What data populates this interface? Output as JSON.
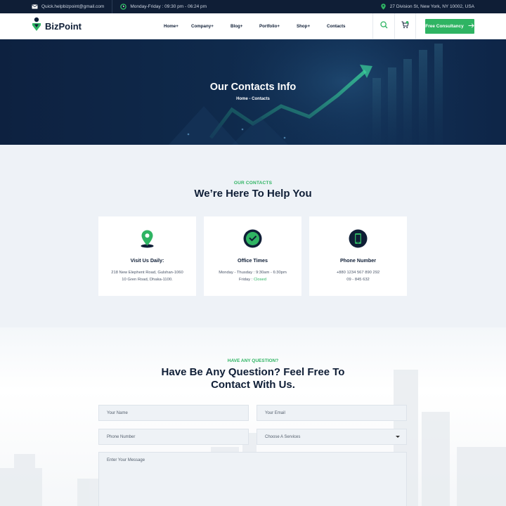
{
  "topbar": {
    "email": "Quick.helpbizpoint@gmail.com",
    "hours": "Monday-Friday : 09:30 pm - 06:24 pm",
    "address": "27 Division St, New York, NY 10002, USA",
    "icons": [
      "mail-icon",
      "clock-icon",
      "location-pin-icon"
    ]
  },
  "header": {
    "logo_text": "BizPoint",
    "nav": [
      "Home+",
      "Company+",
      "Blog+",
      "Portfolio+",
      "Shop+",
      "Contacts"
    ],
    "cta_label": "Free Consultancy",
    "icons": [
      "search-icon",
      "cart-icon",
      "arrow-right-icon"
    ]
  },
  "hero": {
    "title": "Our Contacts Info",
    "breadcrumb": "Home - Contacts"
  },
  "contacts": {
    "eyebrow": "OUR CONTACTS",
    "title": "We’re Here To Help You",
    "cards": [
      {
        "icon": "map-pin-icon",
        "title": "Visit Us Daily:",
        "line1": "218 New Elephent Road, Gulshan-1060",
        "line2": "10 Gren Road, Dhaka-1100."
      },
      {
        "icon": "clock-icon",
        "title": "Office Times",
        "line1": "Monday - Thusday : 9:30am - 6:30pm",
        "line2_prefix": "Friday : ",
        "line2_status": "Closed"
      },
      {
        "icon": "phone-icon",
        "title": "Phone Number",
        "line1": "+880 1234 567 890 292",
        "line2": "09 - 845 632"
      }
    ]
  },
  "form": {
    "eyebrow": "HAVE ANY QUESTION?",
    "title_line1": "Have Be Any Question? Feel Free To",
    "title_line2": "Contact With Us.",
    "name_placeholder": "Your Name",
    "email_placeholder": "Your Email",
    "phone_placeholder": "Phone Number",
    "service_selected": "Choose A Services",
    "message_placeholder": "Enter Your Message"
  },
  "colors": {
    "accent": "#2fb463",
    "dark": "#0f1e36",
    "section_bg": "#eef2f7"
  }
}
